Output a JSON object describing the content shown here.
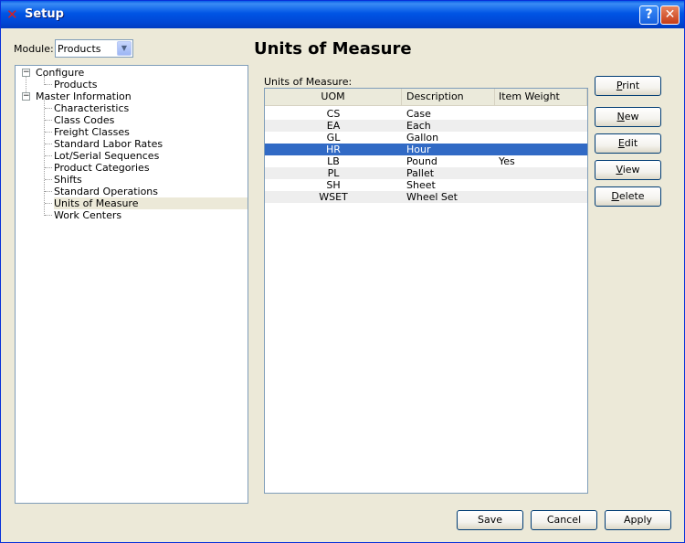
{
  "window": {
    "title": "Setup",
    "help_glyph": "?",
    "close_glyph": "✕"
  },
  "module": {
    "label": "Module:",
    "value": "Products"
  },
  "tree": {
    "items": [
      {
        "label": "Configure",
        "level": 0,
        "expanded": true
      },
      {
        "label": "Products",
        "level": 1
      },
      {
        "label": "Master Information",
        "level": 0,
        "expanded": true
      },
      {
        "label": "Characteristics",
        "level": 1
      },
      {
        "label": "Class Codes",
        "level": 1
      },
      {
        "label": "Freight Classes",
        "level": 1
      },
      {
        "label": "Standard Labor Rates",
        "level": 1
      },
      {
        "label": "Lot/Serial Sequences",
        "level": 1
      },
      {
        "label": "Product Categories",
        "level": 1
      },
      {
        "label": "Shifts",
        "level": 1
      },
      {
        "label": "Standard Operations",
        "level": 1
      },
      {
        "label": "Units of Measure",
        "level": 1,
        "selected": true
      },
      {
        "label": "Work Centers",
        "level": 1
      }
    ]
  },
  "main": {
    "title": "Units of Measure",
    "list_label": "Units of Measure:",
    "columns": [
      "UOM",
      "Description",
      "Item Weight"
    ],
    "rows": [
      {
        "uom": "CS",
        "description": "Case",
        "item_weight": ""
      },
      {
        "uom": "EA",
        "description": "Each",
        "item_weight": ""
      },
      {
        "uom": "GL",
        "description": "Gallon",
        "item_weight": ""
      },
      {
        "uom": "HR",
        "description": "Hour",
        "item_weight": "",
        "selected": true
      },
      {
        "uom": "LB",
        "description": "Pound",
        "item_weight": "Yes"
      },
      {
        "uom": "PL",
        "description": "Pallet",
        "item_weight": ""
      },
      {
        "uom": "SH",
        "description": "Sheet",
        "item_weight": ""
      },
      {
        "uom": "WSET",
        "description": "Wheel Set",
        "item_weight": ""
      }
    ]
  },
  "side_buttons": {
    "print": {
      "mnemonic": "P",
      "rest": "rint"
    },
    "new": {
      "mnemonic": "N",
      "rest": "ew"
    },
    "edit": {
      "mnemonic": "E",
      "rest": "dit"
    },
    "view": {
      "mnemonic": "V",
      "rest": "iew"
    },
    "delete": {
      "mnemonic": "D",
      "rest": "elete"
    }
  },
  "footer": {
    "save": "Save",
    "cancel": "Cancel",
    "apply": "Apply"
  },
  "colors": {
    "selection": "#316ac5",
    "title_bar": "#0055e5",
    "face": "#ece9d8"
  }
}
